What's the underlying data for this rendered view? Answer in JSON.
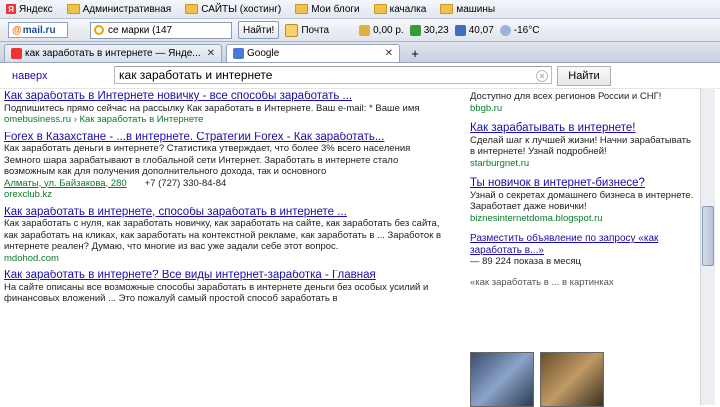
{
  "bookmarks": [
    {
      "label": "Яндекс",
      "icon": "yandex-icon"
    },
    {
      "label": "Административная",
      "icon": "folder-icon"
    },
    {
      "label": "САЙТЫ (хостинг)",
      "icon": "folder-icon"
    },
    {
      "label": "Мои блоги",
      "icon": "folder-icon"
    },
    {
      "label": "качалка",
      "icon": "folder-icon"
    },
    {
      "label": "машины",
      "icon": "folder-icon"
    }
  ],
  "toolbar": {
    "mailru_label": "mail.ru",
    "search_value": "се марки (147",
    "find_button": "Найти!",
    "mail_label": "Почта",
    "balance": "0,00 р.",
    "dollar": "30,23",
    "euro": "40,07",
    "weather": "-16°С"
  },
  "tabs": [
    {
      "label": "как заработать в интернете — Янде...",
      "active": false
    },
    {
      "label": "Google",
      "active": true
    }
  ],
  "search": {
    "back_link": "наверх",
    "query": "как заработать и интернете",
    "button": "Найти"
  },
  "results": [
    {
      "title": "Как заработать в Интернете новичку - все способы заработать ...",
      "snippet": "Подпишитесь прямо сейчас на рассылку Как заработать в Интернете. Ваш e-mail: * Ваше имя",
      "url": "omebusiness.ru › Как заработать в Интернете"
    },
    {
      "title": "Forex в Казахстане - ...в интернете. Стратегии Forex - Как заработать...",
      "snippet": "Как заработать деньги в интернете? Статистика утверждает, что более 3% всего населения Земного шара зарабатывают в глобальной сети Интернет. Заработать в интернете стало возможным как для получения дополнительного дохода, так и основного",
      "url": "Алматы, ул. Байзакова, 280",
      "phone": "+7 (727) 330-84-84",
      "url2": "orexclub.kz"
    },
    {
      "title": "Как заработать в интернете, способы заработать в интернете ...",
      "snippet": "Как заработать с нуля, как заработать новичку, как заработать на сайте, как заработать без сайта, как заработать на кликах, как заработать на контекстной рекламе, как заработать в ... Заработок в интернете реален? Думаю, что многие из вас уже задали себе этот вопрос.",
      "url": "mdohod.com"
    },
    {
      "title": "Как заработать в интернете? Все виды интернет-заработка - Главная",
      "snippet": "На сайте описаны все возможные способы заработать в интернете деньги без особых усилий и финансовых вложений ... Это пожалуй самый простой способ заработать в",
      "url": ""
    }
  ],
  "ads": [
    {
      "title": "",
      "text": "Доступно для всех регионов России и СНГ!",
      "url": "bbgb.ru"
    },
    {
      "title": "Как зарабатывать в интернете!",
      "text": "Сделай шаг к лучшей жизни! Начни зарабатывать в интернете! Узнай подробней!",
      "url": "starburgnet.ru"
    },
    {
      "title": "Ты новичок в интернет-бизнесе?",
      "text": "Узнай о секретах домашнего бизнеса в интернете. Заработает даже новички!",
      "url": "biznesinternetdoma.blogspot.ru"
    },
    {
      "title": "Разместить объявление по запросу «как заработать в...»",
      "text": "— 89 224 показа в месяц",
      "url": ""
    },
    {
      "title": "«как заработать в ... в картинках",
      "text": "",
      "url": ""
    }
  ]
}
